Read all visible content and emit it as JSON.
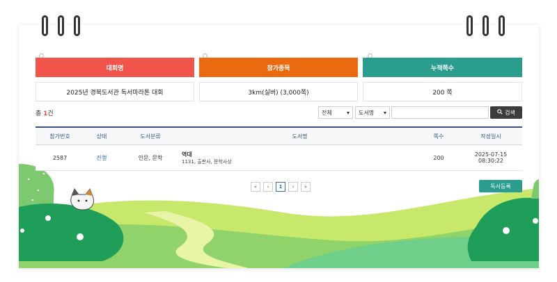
{
  "stats": [
    {
      "label": "대회명",
      "value": "2025년 경북도서관 독서마라톤 대회",
      "color": "#f0544b"
    },
    {
      "label": "참가종목",
      "value": "3km(실버) (3,000쪽)",
      "color": "#ec6a0f"
    },
    {
      "label": "누적쪽수",
      "value": "200 쪽",
      "color": "#2a9d8f"
    }
  ],
  "summary": {
    "prefix": "총 ",
    "count": "1",
    "suffix": "건"
  },
  "filters": {
    "scope": "전체",
    "field": "도서명",
    "search_button": "검색"
  },
  "table": {
    "headers": [
      "참가번호",
      "상태",
      "도서분류",
      "도서명",
      "쪽수",
      "작성일시"
    ],
    "rows": [
      {
        "no": "2587",
        "status": "진행",
        "category": "인문, 문학",
        "title": "역대",
        "sub": "1131, 출판사, 문학사상",
        "pages": "200",
        "date": "2025-07-15",
        "time": "08:30:22"
      }
    ]
  },
  "pager": {
    "first": "«",
    "prev": "‹",
    "current": "1",
    "next": "›",
    "last": "»"
  },
  "register_button": "독서등록"
}
